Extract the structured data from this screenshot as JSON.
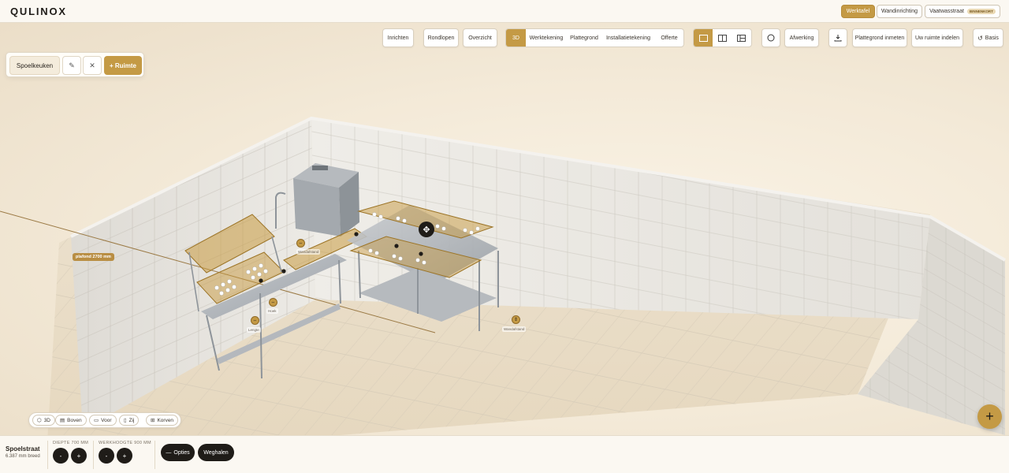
{
  "app": {
    "logo": "QULINOX"
  },
  "modes": [
    {
      "label": "Werktafel",
      "active": true
    },
    {
      "label": "Wandinrichting",
      "active": false
    },
    {
      "label": "Vaatwasstraat",
      "badge": "BINNENKORT",
      "active": false
    }
  ],
  "toolbar": {
    "inrichten": "Inrichten",
    "rondlopen": "Rondlopen",
    "overzicht": "Overzicht",
    "views": [
      "3D",
      "Werktekening",
      "Plattegrond",
      "Installatietekening",
      "Offerte"
    ],
    "active_view": "3D",
    "afwerking": "Afwerking",
    "plattegrond_inmeten": "Plattegrond inmeten",
    "uw_ruimte_indelen": "Uw ruimte indelen",
    "basis": "Basis"
  },
  "room_panel": {
    "room_name": "Spoelkeuken",
    "add_label": "+ Ruimte"
  },
  "scene": {
    "ceiling_label": "plafond 2700 mm",
    "handle_labels": [
      "Wandafstand",
      "Hoek",
      "Lengte",
      "Wandafstand"
    ]
  },
  "camera_views": [
    "3D",
    "Boven",
    "Voor",
    "Zij",
    "Korven"
  ],
  "selection": {
    "name": "Spoelstraat",
    "width": "6.387 mm breed"
  },
  "dimensions": {
    "depth_label": "DIEPTE 700 MM",
    "height_label": "WERKHOOGTE 900 MM",
    "minus": "-",
    "plus": "+"
  },
  "actions": {
    "options": "Opties",
    "remove": "Weghalen"
  },
  "colors": {
    "accent": "#c49a45",
    "dark": "#1f1c18",
    "background": "#f6efe2"
  }
}
